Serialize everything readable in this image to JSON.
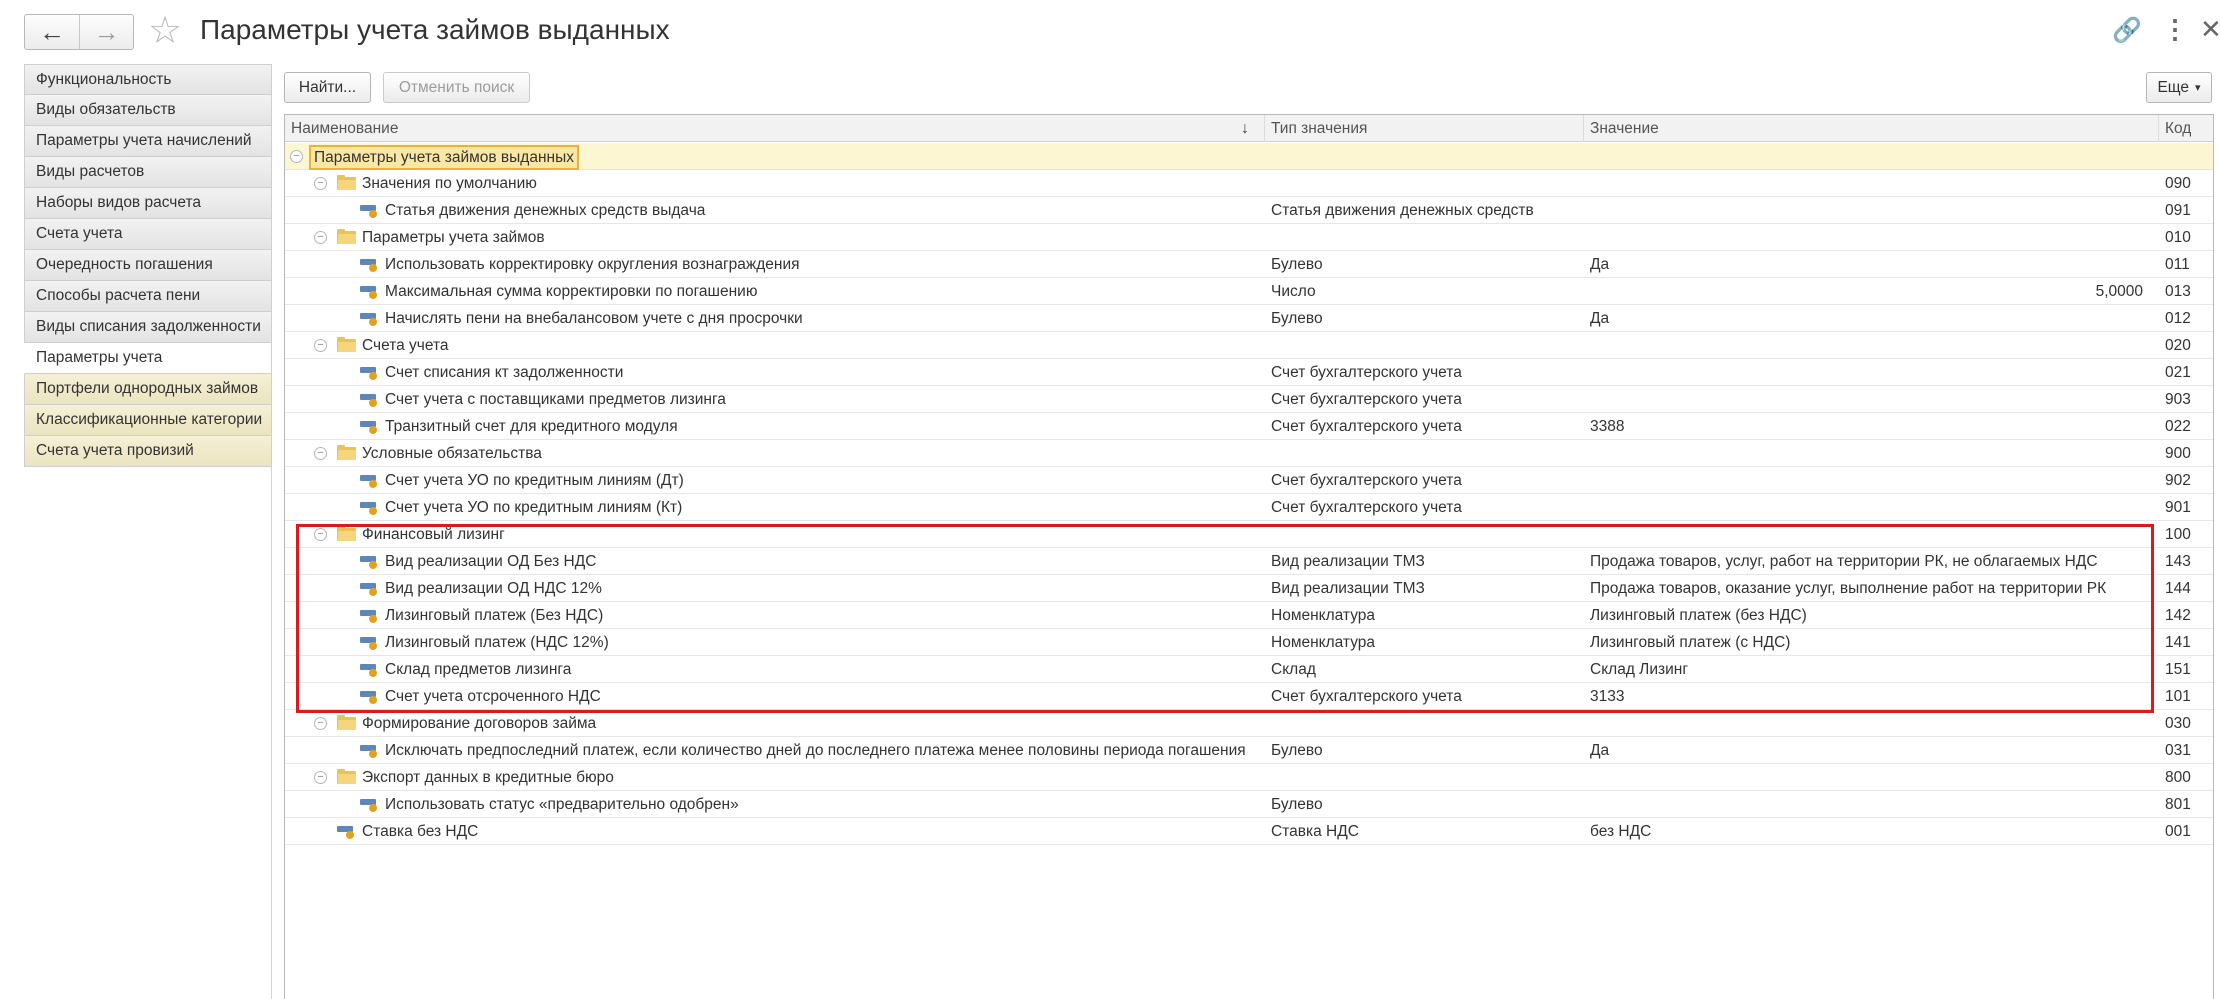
{
  "window": {
    "title": "Параметры учета займов выданных",
    "back_icon": "←",
    "forward_icon": "→",
    "star_icon": "☆",
    "link_icon": "🔗",
    "more_icon": "⋮",
    "close_icon": "✕"
  },
  "sidebar": {
    "items": [
      {
        "label": "Функциональность"
      },
      {
        "label": "Виды обязательств"
      },
      {
        "label": "Параметры учета начислений"
      },
      {
        "label": "Виды расчетов"
      },
      {
        "label": "Наборы видов расчета"
      },
      {
        "label": "Счета учета"
      },
      {
        "label": "Очередность погашения"
      },
      {
        "label": "Способы расчета пени"
      },
      {
        "label": "Виды списания задолженности"
      },
      {
        "label": "Параметры учета"
      },
      {
        "label": "Портфели однородных займов"
      },
      {
        "label": "Классификационные категории"
      },
      {
        "label": "Счета учета провизий"
      }
    ]
  },
  "toolbar": {
    "find_label": "Найти...",
    "cancel_search_label": "Отменить поиск",
    "more_label": "Еще",
    "more_arrow": "▾"
  },
  "table": {
    "columns": {
      "name": "Наименование",
      "sort_icon": "↓",
      "type": "Тип значения",
      "value": "Значение",
      "code": "Код"
    },
    "rows": [
      {
        "name": "Параметры учета займов выданных",
        "type": "",
        "value": "",
        "code": ""
      },
      {
        "name": "Значения по умолчанию",
        "type": "",
        "value": "",
        "code": "090"
      },
      {
        "name": "Статья движения денежных средств выдача",
        "type": "Статья движения денежных средств",
        "value": "",
        "code": "091"
      },
      {
        "name": "Параметры учета займов",
        "type": "",
        "value": "",
        "code": "010"
      },
      {
        "name": "Использовать корректировку округления вознаграждения",
        "type": "Булево",
        "value": "Да",
        "code": "011"
      },
      {
        "name": "Максимальная сумма корректировки по погашению",
        "type": "Число",
        "value": "5,0000",
        "code": "013"
      },
      {
        "name": "Начислять пени на внебалансовом учете с дня просрочки",
        "type": "Булево",
        "value": "Да",
        "code": "012"
      },
      {
        "name": "Счета учета",
        "type": "",
        "value": "",
        "code": "020"
      },
      {
        "name": "Счет списания кт задолженности",
        "type": "Счет бухгалтерского учета",
        "value": "",
        "code": "021"
      },
      {
        "name": "Счет учета с поставщиками предметов лизинга",
        "type": "Счет бухгалтерского учета",
        "value": "",
        "code": "903"
      },
      {
        "name": "Транзитный счет для кредитного модуля",
        "type": "Счет бухгалтерского учета",
        "value": "3388",
        "code": "022"
      },
      {
        "name": "Условные обязательства",
        "type": "",
        "value": "",
        "code": "900"
      },
      {
        "name": "Счет учета УО по кредитным линиям (Дт)",
        "type": "Счет бухгалтерского учета",
        "value": "",
        "code": "902"
      },
      {
        "name": "Счет учета УО по кредитным линиям (Кт)",
        "type": "Счет бухгалтерского учета",
        "value": "",
        "code": "901"
      },
      {
        "name": "Финансовый лизинг",
        "type": "",
        "value": "",
        "code": "100"
      },
      {
        "name": "Вид реализации ОД Без НДС",
        "type": "Вид реализации ТМЗ",
        "value": "Продажа товаров, услуг, работ на территории РК, не облагаемых НДС",
        "code": "143"
      },
      {
        "name": "Вид реализации ОД НДС 12%",
        "type": "Вид реализации ТМЗ",
        "value": "Продажа товаров, оказание услуг, выполнение работ на территории РК",
        "code": "144"
      },
      {
        "name": "Лизинговый платеж  (Без НДС)",
        "type": "Номенклатура",
        "value": "Лизинговый платеж (без НДС)",
        "code": "142"
      },
      {
        "name": "Лизинговый платеж (НДС 12%)",
        "type": "Номенклатура",
        "value": "Лизинговый платеж (с НДС)",
        "code": "141"
      },
      {
        "name": "Склад предметов лизинга",
        "type": "Склад",
        "value": "Склад Лизинг",
        "code": "151"
      },
      {
        "name": "Счет учета отсроченного НДС",
        "type": "Счет бухгалтерского учета",
        "value": "3133",
        "code": "101"
      },
      {
        "name": "Формирование договоров займа",
        "type": "",
        "value": "",
        "code": "030"
      },
      {
        "name": "Исключать предпоследний платеж, если количество дней до последнего платежа менее половины периода погашения",
        "type": "Булево",
        "value": "Да",
        "code": "031"
      },
      {
        "name": "Экспорт данных в кредитные бюро",
        "type": "",
        "value": "",
        "code": "800"
      },
      {
        "name": "Использовать статус «предварительно одобрен»",
        "type": "Булево",
        "value": "",
        "code": "801"
      },
      {
        "name": "Ставка без НДС",
        "type": "Ставка НДС",
        "value": "без НДС",
        "code": "001"
      }
    ],
    "collapse_glyph": "−"
  },
  "colors": {
    "highlight_border": "#dd1a1a",
    "selected_row": "#fdf6d3",
    "folder": "#e9c35a"
  }
}
